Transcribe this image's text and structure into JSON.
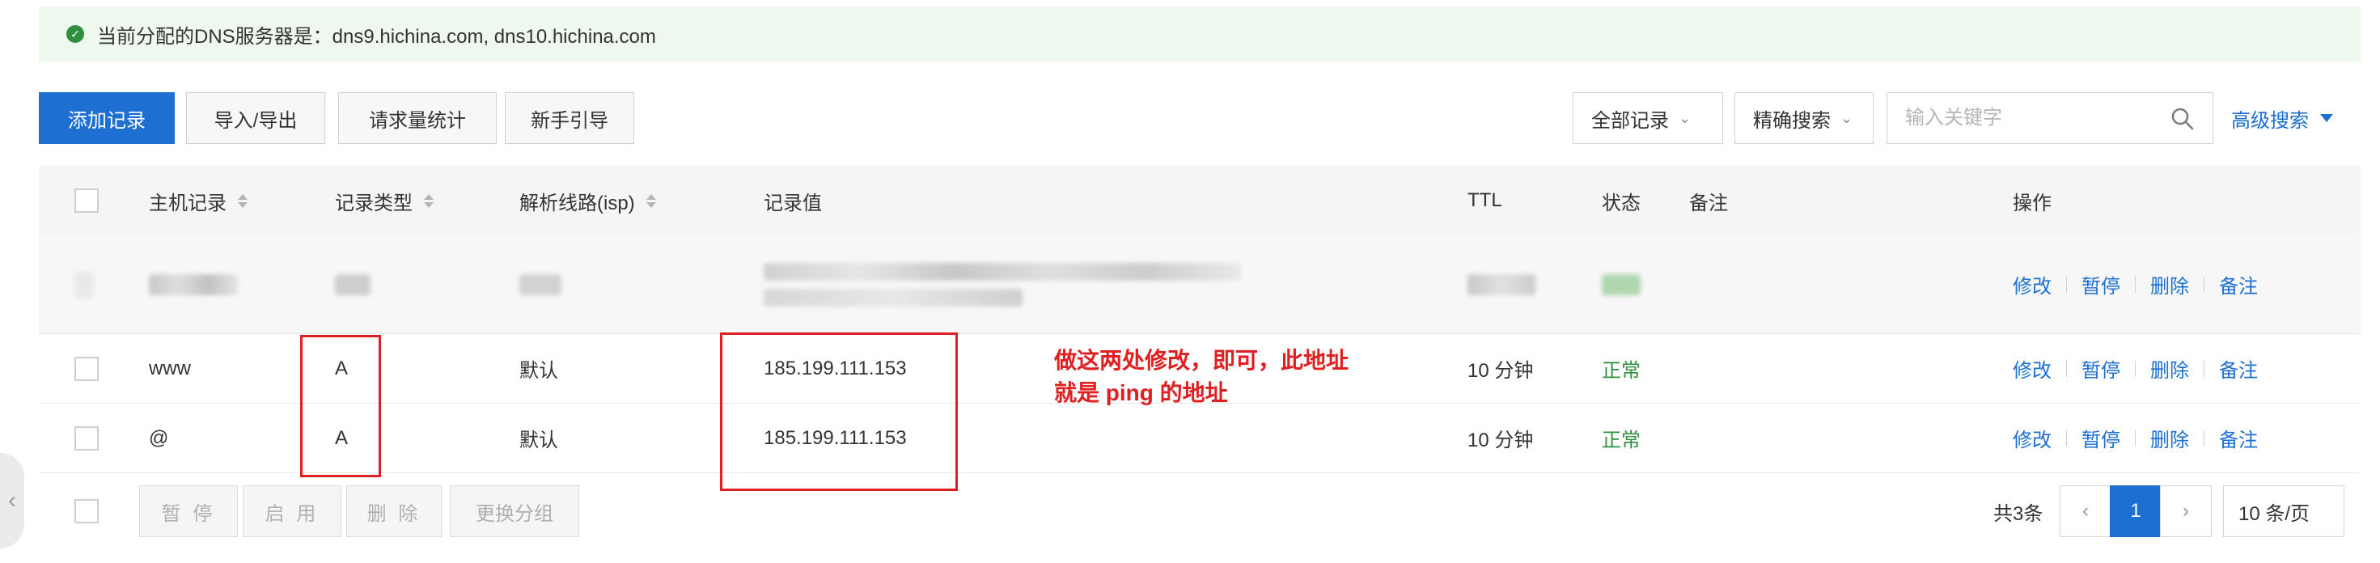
{
  "notice": {
    "text": "当前分配的DNS服务器是：dns9.hichina.com, dns10.hichina.com"
  },
  "toolbar": {
    "add": "添加记录",
    "import_export": "导入/导出",
    "stats": "请求量统计",
    "guide": "新手引导",
    "filter_records": "全部记录",
    "precise_search": "精确搜索",
    "search_placeholder": "输入关键字",
    "advanced_search": "高级搜索"
  },
  "table": {
    "headers": {
      "host": "主机记录",
      "type": "记录类型",
      "line": "解析线路(isp)",
      "value": "记录值",
      "ttl": "TTL",
      "status": "状态",
      "remark": "备注",
      "actions": "操作"
    },
    "rows": [
      {
        "host": "www",
        "type": "A",
        "line": "默认",
        "value": "185.199.111.153",
        "ttl": "10 分钟",
        "status": "正常"
      },
      {
        "host": "@",
        "type": "A",
        "line": "默认",
        "value": "185.199.111.153",
        "ttl": "10 分钟",
        "status": "正常"
      }
    ],
    "actions": {
      "edit": "修改",
      "pause": "暂停",
      "delete": "删除",
      "remark": "备注"
    }
  },
  "annotation": {
    "line1": "做这两处修改，即可，此地址",
    "line2": "就是 ping 的地址"
  },
  "footer": {
    "pause": "暂 停",
    "enable": "启 用",
    "delete": "删 除",
    "change_group": "更换分组",
    "total": "共3条",
    "current_page": "1",
    "per_page": "10 条/页"
  },
  "colors": {
    "primary": "#1d6fd1",
    "success": "#2f8f3e",
    "annotation": "#e02020",
    "notice_bg": "#eef8ee"
  }
}
